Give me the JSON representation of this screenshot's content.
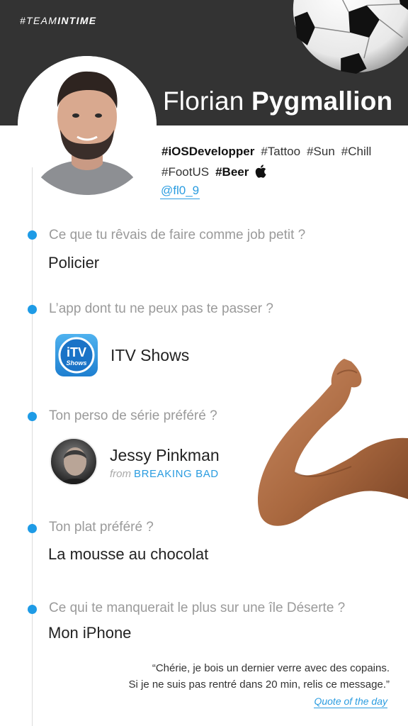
{
  "header": {
    "team_prefix": "#TEAM",
    "team_suffix": "INTIME",
    "first_name": "Florian",
    "last_name": "Pygmallion"
  },
  "tags": {
    "line1": [
      "#iOSDevelopper",
      "#Tattoo",
      "#Sun",
      "#Chill"
    ],
    "line2": [
      "#FootUS",
      "#Beer"
    ],
    "handle": "@fl0_9"
  },
  "qa": [
    {
      "question": "Ce que tu rêvais de faire comme job petit ?",
      "answer": "Policier"
    },
    {
      "question": "L’app dont tu ne peux pas te passer ?",
      "answer": "ITV Shows"
    },
    {
      "question": "Ton perso de série préféré ?",
      "answer": "Jessy Pinkman",
      "from": "from",
      "show": "BREAKING BAD"
    },
    {
      "question": "Ton plat préféré ?",
      "answer": "La mousse au chocolat"
    },
    {
      "question": "Ce qui te manquerait le plus sur une île Déserte ?",
      "answer": "Mon iPhone"
    }
  ],
  "app_icon": {
    "line1": "iTV",
    "line2": "Shows"
  },
  "quote": {
    "line1": "“Chérie, je bois un dernier verre avec des copains.",
    "line2": "Si je ne suis pas rentré dans 20 min, relis ce message.”",
    "link": "Quote of the day"
  },
  "colors": {
    "accent": "#1e9be6",
    "header_bg": "#333333",
    "question": "#9a9a9a"
  },
  "icons": [
    "soccer-ball-icon",
    "apple-icon",
    "itv-shows-app-icon",
    "flexed-arm-image"
  ]
}
